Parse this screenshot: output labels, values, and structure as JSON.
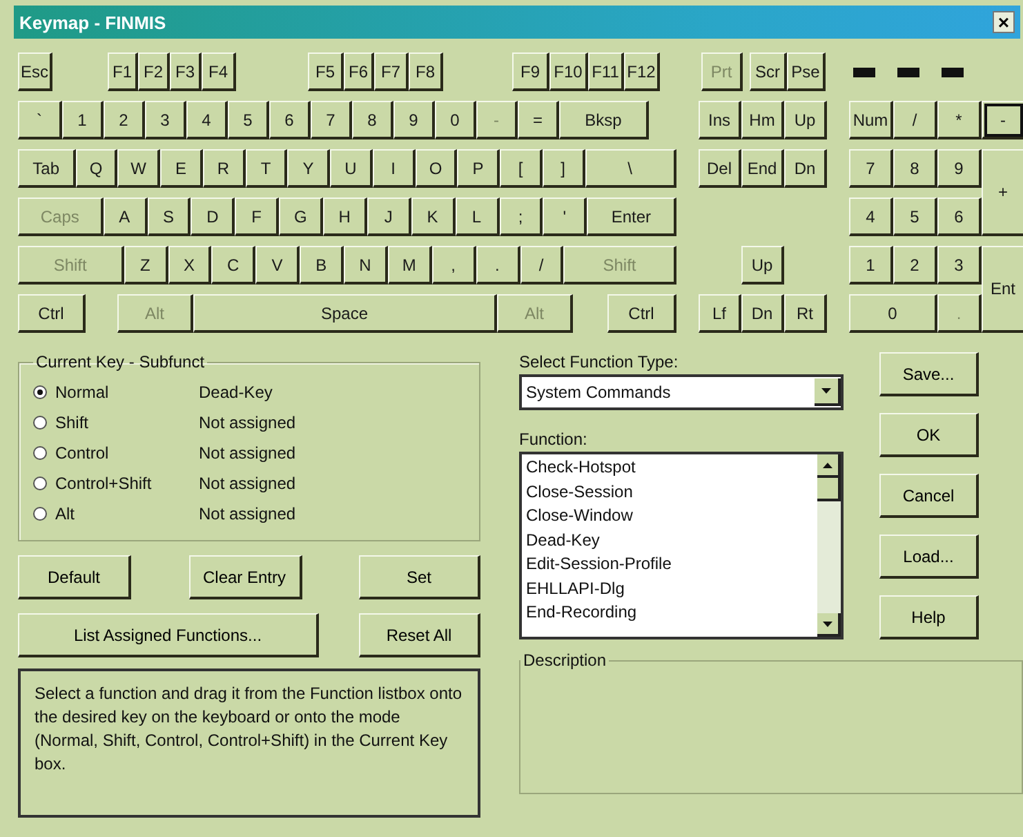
{
  "window": {
    "title": "Keymap - FINMIS",
    "close": "×"
  },
  "keyboard": {
    "function_row": [
      {
        "label": "Esc",
        "disabled": false
      },
      {
        "label": "F1",
        "disabled": false
      },
      {
        "label": "F2",
        "disabled": false
      },
      {
        "label": "F3",
        "disabled": false
      },
      {
        "label": "F4",
        "disabled": false
      },
      {
        "label": "F5",
        "disabled": false
      },
      {
        "label": "F6",
        "disabled": false
      },
      {
        "label": "F7",
        "disabled": false
      },
      {
        "label": "F8",
        "disabled": false
      },
      {
        "label": "F9",
        "disabled": false
      },
      {
        "label": "F10",
        "disabled": false
      },
      {
        "label": "F11",
        "disabled": false
      },
      {
        "label": "F12",
        "disabled": false
      },
      {
        "label": "Prt",
        "disabled": true
      },
      {
        "label": "Scr",
        "disabled": false
      },
      {
        "label": "Pse",
        "disabled": false
      }
    ],
    "main_rows": [
      [
        {
          "label": "`",
          "disabled": false
        },
        {
          "label": "1",
          "disabled": false
        },
        {
          "label": "2",
          "disabled": false
        },
        {
          "label": "3",
          "disabled": false
        },
        {
          "label": "4",
          "disabled": false
        },
        {
          "label": "5",
          "disabled": false
        },
        {
          "label": "6",
          "disabled": false
        },
        {
          "label": "7",
          "disabled": false
        },
        {
          "label": "8",
          "disabled": false
        },
        {
          "label": "9",
          "disabled": false
        },
        {
          "label": "0",
          "disabled": false
        },
        {
          "label": "-",
          "disabled": true
        },
        {
          "label": "=",
          "disabled": false
        },
        {
          "label": "Bksp",
          "disabled": false
        }
      ],
      [
        {
          "label": "Tab",
          "disabled": false
        },
        {
          "label": "Q",
          "disabled": false
        },
        {
          "label": "W",
          "disabled": false
        },
        {
          "label": "E",
          "disabled": false
        },
        {
          "label": "R",
          "disabled": false
        },
        {
          "label": "T",
          "disabled": false
        },
        {
          "label": "Y",
          "disabled": false
        },
        {
          "label": "U",
          "disabled": false
        },
        {
          "label": "I",
          "disabled": false
        },
        {
          "label": "O",
          "disabled": false
        },
        {
          "label": "P",
          "disabled": false
        },
        {
          "label": "[",
          "disabled": false
        },
        {
          "label": "]",
          "disabled": false
        },
        {
          "label": "\\",
          "disabled": false
        }
      ],
      [
        {
          "label": "Caps",
          "disabled": true
        },
        {
          "label": "A",
          "disabled": false
        },
        {
          "label": "S",
          "disabled": false
        },
        {
          "label": "D",
          "disabled": false
        },
        {
          "label": "F",
          "disabled": false
        },
        {
          "label": "G",
          "disabled": false
        },
        {
          "label": "H",
          "disabled": false
        },
        {
          "label": "J",
          "disabled": false
        },
        {
          "label": "K",
          "disabled": false
        },
        {
          "label": "L",
          "disabled": false
        },
        {
          "label": ";",
          "disabled": false
        },
        {
          "label": "'",
          "disabled": false
        },
        {
          "label": "Enter",
          "disabled": false
        }
      ],
      [
        {
          "label": "Shift",
          "disabled": true
        },
        {
          "label": "Z",
          "disabled": false
        },
        {
          "label": "X",
          "disabled": false
        },
        {
          "label": "C",
          "disabled": false
        },
        {
          "label": "V",
          "disabled": false
        },
        {
          "label": "B",
          "disabled": false
        },
        {
          "label": "N",
          "disabled": false
        },
        {
          "label": "M",
          "disabled": false
        },
        {
          "label": ",",
          "disabled": false
        },
        {
          "label": ".",
          "disabled": false
        },
        {
          "label": "/",
          "disabled": false
        },
        {
          "label": "Shift",
          "disabled": true
        }
      ],
      [
        {
          "label": "Ctrl",
          "disabled": false
        },
        {
          "label": "Alt",
          "disabled": true
        },
        {
          "label": "Space",
          "disabled": false
        },
        {
          "label": "Alt",
          "disabled": true
        },
        {
          "label": "Ctrl",
          "disabled": false
        }
      ]
    ],
    "nav_keys": [
      {
        "label": "Ins",
        "disabled": false
      },
      {
        "label": "Hm",
        "disabled": false
      },
      {
        "label": "Up",
        "disabled": false
      },
      {
        "label": "Del",
        "disabled": false
      },
      {
        "label": "End",
        "disabled": false
      },
      {
        "label": "Dn",
        "disabled": false
      },
      {
        "label": "Up",
        "disabled": false
      },
      {
        "label": "Lf",
        "disabled": false
      },
      {
        "label": "Dn",
        "disabled": false
      },
      {
        "label": "Rt",
        "disabled": false
      }
    ],
    "numpad_keys": [
      {
        "label": "Num",
        "disabled": false,
        "selected": false
      },
      {
        "label": "/",
        "disabled": false,
        "selected": false
      },
      {
        "label": "*",
        "disabled": false,
        "selected": false
      },
      {
        "label": "-",
        "disabled": false,
        "selected": true
      },
      {
        "label": "7",
        "disabled": false,
        "selected": false
      },
      {
        "label": "8",
        "disabled": false,
        "selected": false
      },
      {
        "label": "9",
        "disabled": false,
        "selected": false
      },
      {
        "label": "+",
        "disabled": false,
        "selected": false
      },
      {
        "label": "4",
        "disabled": false,
        "selected": false
      },
      {
        "label": "5",
        "disabled": false,
        "selected": false
      },
      {
        "label": "6",
        "disabled": false,
        "selected": false
      },
      {
        "label": "1",
        "disabled": false,
        "selected": false
      },
      {
        "label": "2",
        "disabled": false,
        "selected": false
      },
      {
        "label": "3",
        "disabled": false,
        "selected": false
      },
      {
        "label": "Ent",
        "disabled": false,
        "selected": false
      },
      {
        "label": "0",
        "disabled": false,
        "selected": false
      },
      {
        "label": ".",
        "disabled": true,
        "selected": false
      }
    ]
  },
  "current_key": {
    "title": "Current Key - Subfunct",
    "modes": [
      {
        "label": "Normal",
        "value": "Dead-Key",
        "selected": true
      },
      {
        "label": "Shift",
        "value": "Not assigned",
        "selected": false
      },
      {
        "label": "Control",
        "value": "Not assigned",
        "selected": false
      },
      {
        "label": "Control+Shift",
        "value": "Not assigned",
        "selected": false
      },
      {
        "label": "Alt",
        "value": "Not assigned",
        "selected": false
      }
    ]
  },
  "left_buttons": [
    "Default",
    "Clear Entry",
    "Set",
    "List Assigned Functions...",
    "Reset All"
  ],
  "hint": "Select a function and drag it from the Function listbox onto the desired key on the keyboard or onto the mode (Normal, Shift, Control, Control+Shift) in the Current Key box.",
  "function_type": {
    "label": "Select Function Type:",
    "value": "System Commands"
  },
  "function_list": {
    "label": "Function:",
    "items": [
      "Check-Hotspot",
      "Close-Session",
      "Close-Window",
      "Dead-Key",
      "Edit-Session-Profile",
      "EHLLAPI-Dlg",
      "End-Recording"
    ]
  },
  "description": {
    "title": "Description"
  },
  "right_buttons": [
    "Save...",
    "OK",
    "Cancel",
    "Load...",
    "Help"
  ]
}
